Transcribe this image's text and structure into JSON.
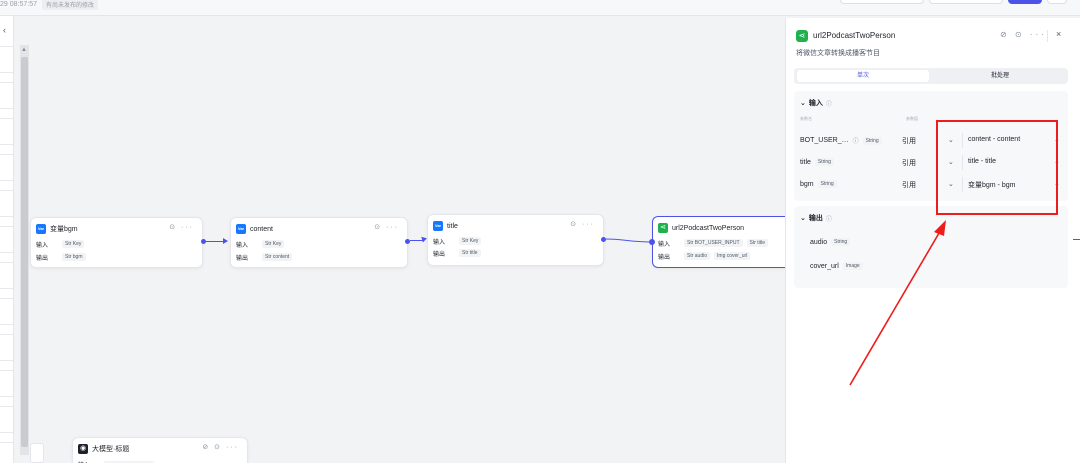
{
  "topbar": {
    "timestamp": "29 08:57:57",
    "draft_label": "有尚未发布的修改"
  },
  "nodes": {
    "bgm": {
      "badge": "Var",
      "title": "变量bgm",
      "input_label": "输入",
      "input_type": "Str",
      "input_value": "Key",
      "output_label": "输出",
      "output_type": "Str",
      "output_value": "bgm"
    },
    "content": {
      "badge": "Var",
      "title": "content",
      "input_label": "输入",
      "input_type": "Str",
      "input_value": "Key",
      "output_label": "输出",
      "output_type": "Str",
      "output_value": "content"
    },
    "title": {
      "badge": "Var",
      "title": "title",
      "input_label": "输入",
      "input_type": "Str",
      "input_value": "Key",
      "output_label": "输出",
      "output_type": "Str",
      "output_value": "title"
    },
    "plugin": {
      "title": "url2PodcastTwoPerson",
      "input_label": "输入",
      "input_type1": "Str",
      "input_value1": "BOT_USER_INPUT",
      "input_type2": "Str",
      "input_value2": "title",
      "output_label": "输出",
      "output_type1": "Str",
      "output_value1": "audio",
      "output_type2": "Img",
      "output_value2": "cover_url"
    },
    "llm": {
      "title": "大模型·标题",
      "input_label": "输入"
    }
  },
  "panel": {
    "title": "url2PodcastTwoPerson",
    "description": "将微信文章转换成播客节目",
    "tabs": [
      "单次",
      "批处理"
    ],
    "input_section": {
      "label": "输入",
      "col_name": "参数名",
      "col_value": "参数值",
      "rows": [
        {
          "name": "BOT_USER_…",
          "type": "String",
          "mode": "引用",
          "value": "content - content"
        },
        {
          "name": "title",
          "type": "String",
          "mode": "引用",
          "value": "title - title"
        },
        {
          "name": "bgm",
          "type": "String",
          "mode": "引用",
          "value": "变量bgm - bgm"
        }
      ]
    },
    "output_section": {
      "label": "输出",
      "rows": [
        {
          "name": "audio",
          "type": "String"
        },
        {
          "name": "cover_url",
          "type": "Image"
        }
      ]
    }
  },
  "colors": {
    "accent": "#4d53e8",
    "plugin_green": "#20b14f",
    "var_blue": "#1677ff",
    "annotation_red": "#ee1c1c"
  }
}
